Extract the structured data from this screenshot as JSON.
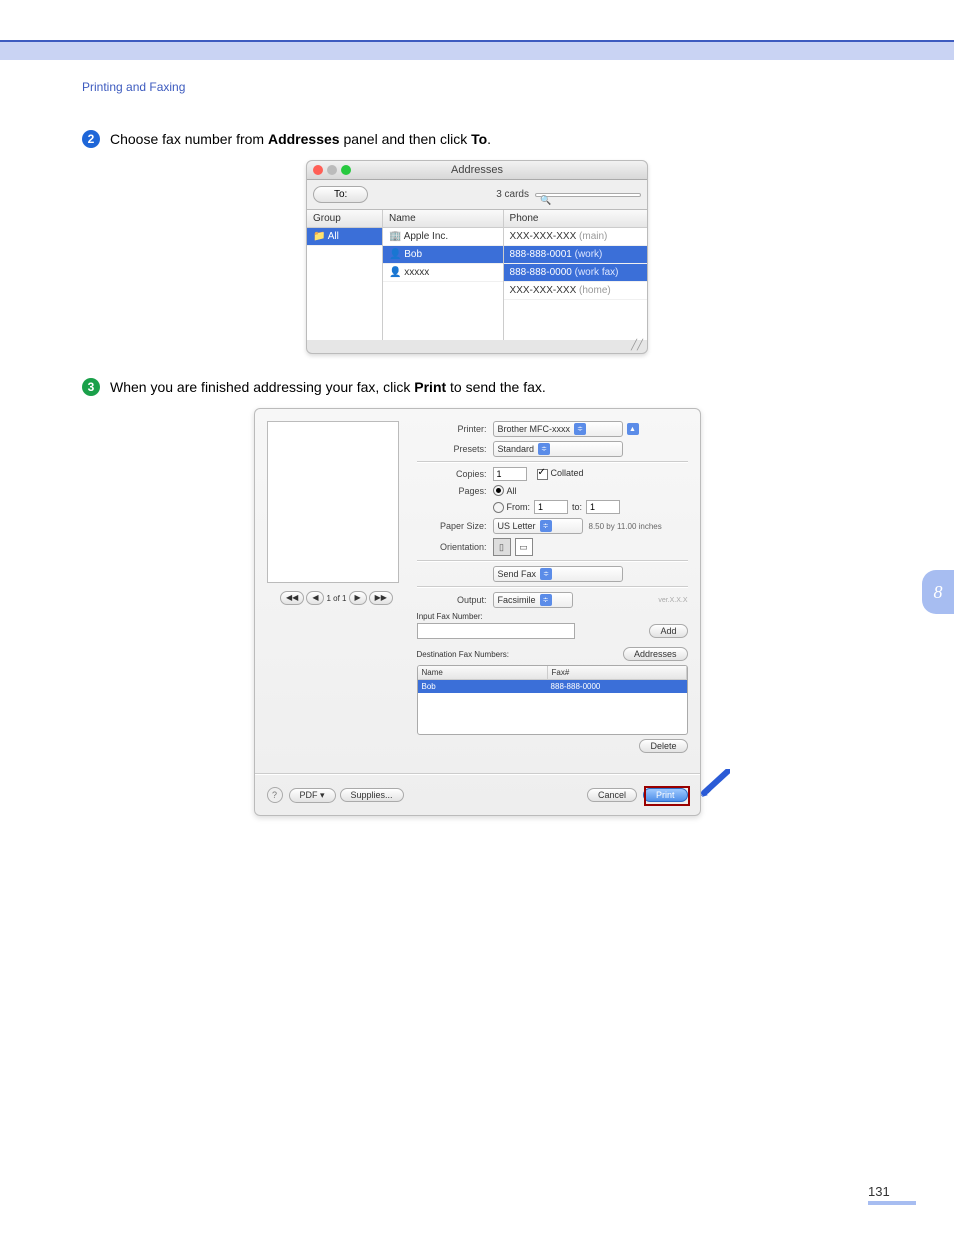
{
  "header_text": "Printing and Faxing",
  "step2": {
    "num": "2",
    "text_pre": "Choose fax number from ",
    "bold1": "Addresses",
    "text_mid": " panel and then click ",
    "bold2": "To",
    "text_post": "."
  },
  "step3": {
    "num": "3",
    "text_pre": "When you are finished addressing your fax, click ",
    "bold1": "Print",
    "text_post": " to send the fax."
  },
  "addresses_window": {
    "title": "Addresses",
    "to_button": "To:",
    "cards_label": "3 cards",
    "search_placeholder": "",
    "columns": {
      "group": "Group",
      "name": "Name",
      "phone": "Phone"
    },
    "group_rows": [
      "All"
    ],
    "name_rows": [
      "Apple Inc.",
      "Bob",
      "xxxxx"
    ],
    "phone_rows": [
      {
        "num": "XXX-XXX-XXX",
        "type": "(main)"
      },
      {
        "num": "888-888-0001",
        "type": "(work)"
      },
      {
        "num": "888-888-0000",
        "type": "(work fax)"
      },
      {
        "num": "XXX-XXX-XXX",
        "type": "(home)"
      }
    ],
    "selected_name_index": 1,
    "selected_phone_index": 2
  },
  "print_dialog": {
    "labels": {
      "printer": "Printer:",
      "presets": "Presets:",
      "copies": "Copies:",
      "collated": "Collated",
      "pages": "Pages:",
      "all": "All",
      "from": "From:",
      "to": "to:",
      "paper_size": "Paper Size:",
      "orientation": "Orientation:",
      "output": "Output:",
      "input_fax": "Input Fax Number:",
      "dest_fax": "Destination Fax Numbers:",
      "name_col": "Name",
      "fax_col": "Fax#"
    },
    "values": {
      "printer": "Brother MFC-xxxx",
      "presets": "Standard",
      "copies": "1",
      "from": "1",
      "to": "1",
      "paper_size": "US Letter",
      "paper_dim": "8.50 by 11.00 inches",
      "panel": "Send Fax",
      "output": "Facsimile",
      "input_fax": "",
      "preview_page": "1 of 1",
      "dest_name": "Bob",
      "dest_fax": "888-888-0000"
    },
    "buttons": {
      "add": "Add",
      "addresses": "Addresses",
      "delete": "Delete",
      "pdf": "PDF ▾",
      "supplies": "Supplies...",
      "cancel": "Cancel",
      "print": "Print"
    }
  },
  "chapter_tab": "8",
  "page_number": "131"
}
